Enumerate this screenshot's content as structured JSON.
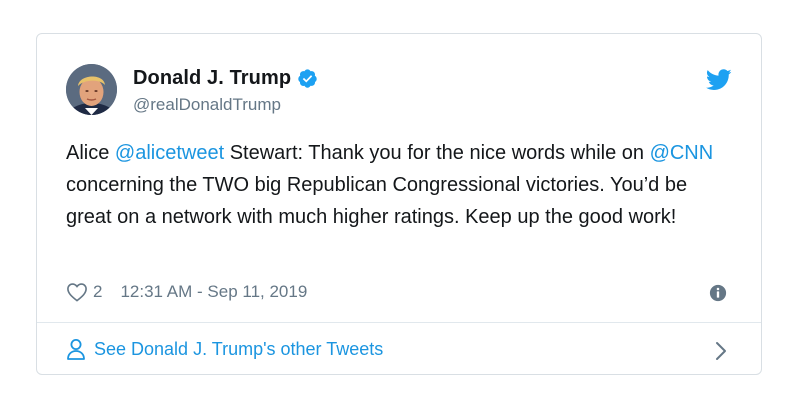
{
  "author": {
    "display_name": "Donald J. Trump",
    "handle": "@realDonaldTrump",
    "verified": true,
    "avatar_icon": "avatar-photo"
  },
  "tweet": {
    "segments": [
      {
        "text": "Alice ",
        "type": "text"
      },
      {
        "text": "@alicetweet",
        "type": "mention"
      },
      {
        "text": " Stewart: Thank you for the nice words while on ",
        "type": "text"
      },
      {
        "text": "@CNN",
        "type": "mention"
      },
      {
        "text": " concerning the TWO big Republican Congressional victories. You’d be great on a network with much higher ratings. Keep up the good work!",
        "type": "text"
      }
    ]
  },
  "meta": {
    "like_count": "2",
    "timestamp": "12:31 AM - Sep 11, 2019"
  },
  "footer": {
    "link_label": "See Donald J. Trump's other Tweets"
  },
  "icons": {
    "like": "heart-icon",
    "info": "info-icon",
    "brand": "twitter-bird-icon",
    "verified": "verified-badge-icon",
    "profile": "person-icon",
    "chevron": "chevron-right-icon"
  },
  "colors": {
    "brand_blue": "#1da1f2",
    "link_blue": "#1b95e0",
    "text_primary": "#14171a",
    "text_secondary": "#657786",
    "border": "#d9dfe4"
  }
}
